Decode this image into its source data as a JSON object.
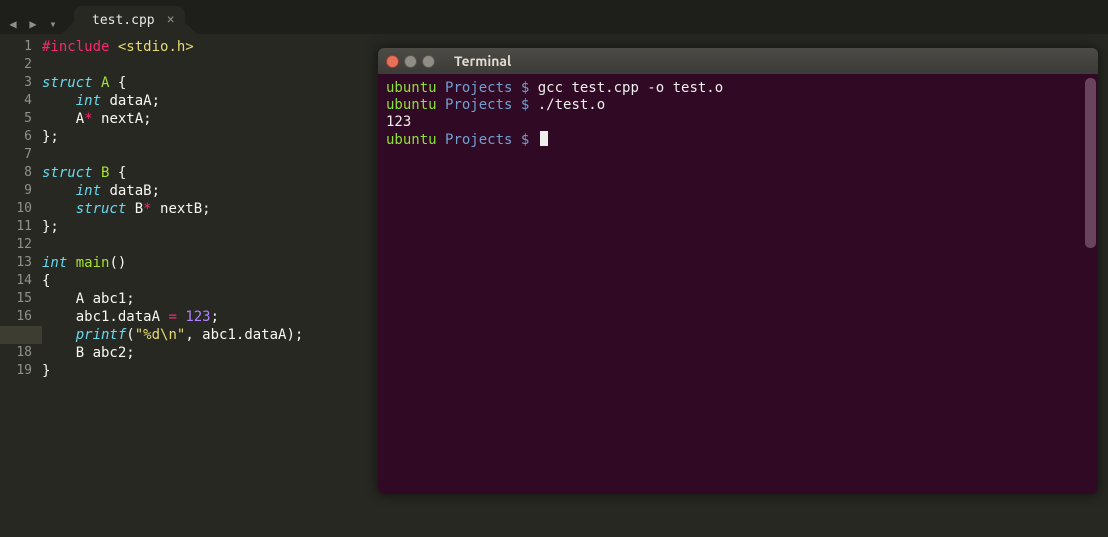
{
  "editor": {
    "tab_filename": "test.cpp",
    "highlighted_line": 17,
    "code_lines": [
      [
        {
          "cls": "tok-red",
          "t": "#include"
        },
        {
          "cls": "tok-default",
          "t": " "
        },
        {
          "cls": "tok-yellow",
          "t": "<stdio.h>"
        }
      ],
      [],
      [
        {
          "cls": "tok-cyan",
          "t": "struct"
        },
        {
          "cls": "tok-default",
          "t": " "
        },
        {
          "cls": "tok-green",
          "t": "A"
        },
        {
          "cls": "tok-default",
          "t": " {"
        }
      ],
      [
        {
          "cls": "tok-default",
          "t": "    "
        },
        {
          "cls": "tok-cyan",
          "t": "int"
        },
        {
          "cls": "tok-default",
          "t": " dataA;"
        }
      ],
      [
        {
          "cls": "tok-default",
          "t": "    A"
        },
        {
          "cls": "tok-red",
          "t": "*"
        },
        {
          "cls": "tok-default",
          "t": " nextA;"
        }
      ],
      [
        {
          "cls": "tok-default",
          "t": "};"
        }
      ],
      [],
      [
        {
          "cls": "tok-cyan",
          "t": "struct"
        },
        {
          "cls": "tok-default",
          "t": " "
        },
        {
          "cls": "tok-green",
          "t": "B"
        },
        {
          "cls": "tok-default",
          "t": " {"
        }
      ],
      [
        {
          "cls": "tok-default",
          "t": "    "
        },
        {
          "cls": "tok-cyan",
          "t": "int"
        },
        {
          "cls": "tok-default",
          "t": " dataB;"
        }
      ],
      [
        {
          "cls": "tok-default",
          "t": "    "
        },
        {
          "cls": "tok-cyan",
          "t": "struct"
        },
        {
          "cls": "tok-default",
          "t": " B"
        },
        {
          "cls": "tok-red",
          "t": "*"
        },
        {
          "cls": "tok-default",
          "t": " nextB;"
        }
      ],
      [
        {
          "cls": "tok-default",
          "t": "};"
        }
      ],
      [],
      [
        {
          "cls": "tok-cyan",
          "t": "int"
        },
        {
          "cls": "tok-default",
          "t": " "
        },
        {
          "cls": "tok-green",
          "t": "main"
        },
        {
          "cls": "tok-default",
          "t": "()"
        }
      ],
      [
        {
          "cls": "tok-default",
          "t": "{"
        }
      ],
      [
        {
          "cls": "tok-default",
          "t": "    A abc1;"
        }
      ],
      [
        {
          "cls": "tok-default",
          "t": "    abc1.dataA "
        },
        {
          "cls": "tok-red",
          "t": "="
        },
        {
          "cls": "tok-default",
          "t": " "
        },
        {
          "cls": "tok-purple",
          "t": "123"
        },
        {
          "cls": "tok-default",
          "t": ";"
        }
      ],
      [
        {
          "cls": "tok-default",
          "t": "    "
        },
        {
          "cls": "tok-cyan",
          "t": "printf"
        },
        {
          "cls": "tok-default",
          "t": "("
        },
        {
          "cls": "tok-yellow",
          "t": "\"%d\\n\""
        },
        {
          "cls": "tok-default",
          "t": ", abc1.dataA);"
        }
      ],
      [
        {
          "cls": "tok-default",
          "t": "    B abc2;"
        }
      ],
      [
        {
          "cls": "tok-default",
          "t": "}"
        }
      ]
    ]
  },
  "terminal": {
    "title": "Terminal",
    "prompt_user": "ubuntu",
    "prompt_dir": "Projects",
    "prompt_symbol": "$",
    "lines": [
      {
        "type": "prompt",
        "cmd": "gcc test.cpp -o test.o"
      },
      {
        "type": "prompt",
        "cmd": "./test.o"
      },
      {
        "type": "output",
        "text": "123"
      },
      {
        "type": "prompt",
        "cmd": "",
        "cursor": true
      }
    ]
  }
}
